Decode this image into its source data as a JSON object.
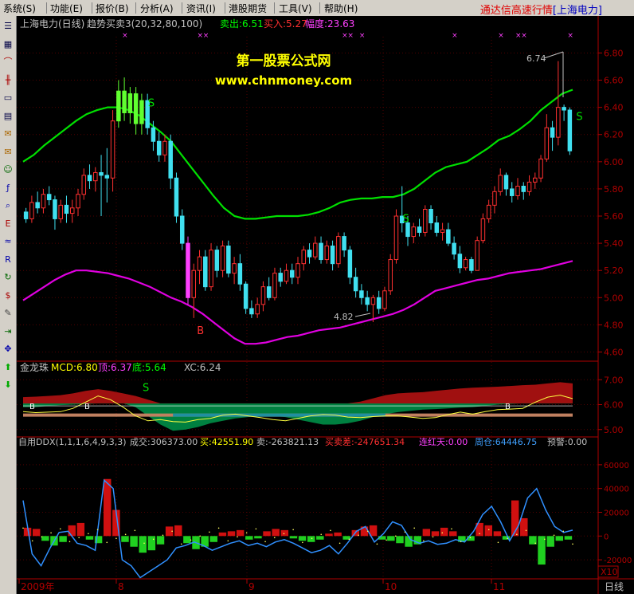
{
  "menu": [
    "系统(S)",
    "功能(E)",
    "报价(B)",
    "分析(A)",
    "资讯(I)",
    "港股期货",
    "工具(V)",
    "帮助(H)"
  ],
  "app_title": {
    "prefix": "通达信高速行情",
    "stock": "[上海电力]"
  },
  "toolbar_icons": [
    "list-icon",
    "grid-icon",
    "line-chart-icon",
    "candle-chart-icon",
    "window-icon",
    "table-icon",
    "news-icon",
    "mail-icon",
    "users-icon",
    "fund-icon",
    "search-icon",
    "etf-icon",
    "wave-icon",
    "rsi-icon",
    "refresh-icon",
    "dollar-icon",
    "tools-icon",
    "exit-icon",
    "move-icon",
    "up-arrow-icon",
    "down-arrow-icon"
  ],
  "main_header": {
    "title": "上海电力(日线)",
    "indicator": "趋势买卖3(20,32,80,100)",
    "sell": "卖出:6.51",
    "buy": "买入:5.27",
    "amp": "幅度:23.63",
    "colors": {
      "title": "#c0c0c0",
      "sell": "#00ff00",
      "buy": "#ff3030",
      "amp": "#ff40ff"
    }
  },
  "watermark": {
    "line1": "第一股票公式网",
    "line2": "www.chnmoney.com"
  },
  "price_annotations": {
    "high": "6.74",
    "low": "4.82"
  },
  "signal_labels": {
    "sell": "S",
    "buy": "B"
  },
  "price_axis": [
    "6.80",
    "6.60",
    "6.40",
    "6.20",
    "6.00",
    "5.80",
    "5.60",
    "5.40",
    "5.20",
    "5.00",
    "4.80",
    "4.60"
  ],
  "mcd_header": {
    "name": "金龙珠",
    "mcd": "MCD:6.80",
    "top": "顶:6.37",
    "bottom": "底:5.64",
    "xc": "XC:6.24"
  },
  "mcd_axis": [
    "7.00",
    "6.00",
    "5.00"
  ],
  "ddx_header": {
    "name": "自用DDX(1,1,1,6,4,9,3,3)",
    "vol": "成交:306373.00",
    "buy": "买:42551.90",
    "sell": "卖:-263821.13",
    "diff": "买卖差:-247651.34",
    "red": "连红天:0.00",
    "week": "周仓:64446.75",
    "warn": "预警:0.00"
  },
  "ddx_axis": [
    "60000",
    "40000",
    "20000",
    "0",
    "-20000"
  ],
  "ddx_scale": "X10",
  "date_axis": [
    "2009年",
    "8",
    "9",
    "10",
    "11"
  ],
  "period_label": "日线",
  "chart_data": [
    {
      "type": "candlestick",
      "name": "main",
      "ylim": [
        4.55,
        6.92
      ],
      "ohlc": [
        [
          5.63,
          5.66,
          5.55,
          5.58
        ],
        [
          5.58,
          5.75,
          5.55,
          5.7
        ],
        [
          5.7,
          5.78,
          5.62,
          5.66
        ],
        [
          5.66,
          5.8,
          5.62,
          5.76
        ],
        [
          5.76,
          5.82,
          5.68,
          5.72
        ],
        [
          5.72,
          5.75,
          5.5,
          5.58
        ],
        [
          5.58,
          5.72,
          5.55,
          5.68
        ],
        [
          5.68,
          5.75,
          5.55,
          5.62
        ],
        [
          5.62,
          5.72,
          5.55,
          5.66
        ],
        [
          5.66,
          5.8,
          5.6,
          5.76
        ],
        [
          5.76,
          5.95,
          5.72,
          5.9
        ],
        [
          5.9,
          5.98,
          5.8,
          5.86
        ],
        [
          5.86,
          5.96,
          5.78,
          5.92
        ],
        [
          5.92,
          6.05,
          5.6,
          5.9
        ],
        [
          5.9,
          6.1,
          5.7,
          5.88
        ],
        [
          5.88,
          6.38,
          5.78,
          6.3
        ],
        [
          6.3,
          6.6,
          6.25,
          6.52
        ],
        [
          6.52,
          6.62,
          6.3,
          6.36
        ],
        [
          6.36,
          6.55,
          6.28,
          6.5
        ],
        [
          6.5,
          6.55,
          6.2,
          6.28
        ],
        [
          6.28,
          6.5,
          6.2,
          6.45
        ],
        [
          6.45,
          6.5,
          6.2,
          6.25
        ],
        [
          6.25,
          6.3,
          6.08,
          6.15
        ],
        [
          6.15,
          6.22,
          6.0,
          6.05
        ],
        [
          6.05,
          6.2,
          6.0,
          6.15
        ],
        [
          6.15,
          6.2,
          5.8,
          5.88
        ],
        [
          5.88,
          5.92,
          5.55,
          5.6
        ],
        [
          5.6,
          5.65,
          5.35,
          5.4
        ],
        [
          5.4,
          5.45,
          4.95,
          5.0
        ],
        [
          5.0,
          5.25,
          4.85,
          5.2
        ],
        [
          5.2,
          5.35,
          5.1,
          5.3
        ],
        [
          5.3,
          5.35,
          5.05,
          5.08
        ],
        [
          5.08,
          5.4,
          5.05,
          5.35
        ],
        [
          5.35,
          5.38,
          5.15,
          5.2
        ],
        [
          5.2,
          5.42,
          5.15,
          5.38
        ],
        [
          5.38,
          5.42,
          5.15,
          5.18
        ],
        [
          5.18,
          5.3,
          5.1,
          5.25
        ],
        [
          5.25,
          5.32,
          5.05,
          5.1
        ],
        [
          5.1,
          5.12,
          4.88,
          4.92
        ],
        [
          4.92,
          4.98,
          4.85,
          4.88
        ],
        [
          4.88,
          5.0,
          4.85,
          4.95
        ],
        [
          4.95,
          5.12,
          4.9,
          5.08
        ],
        [
          5.08,
          5.15,
          4.98,
          5.0
        ],
        [
          5.0,
          5.22,
          4.98,
          5.18
        ],
        [
          5.18,
          5.22,
          5.08,
          5.12
        ],
        [
          5.12,
          5.25,
          5.1,
          5.2
        ],
        [
          5.2,
          5.25,
          5.1,
          5.15
        ],
        [
          5.15,
          5.3,
          5.1,
          5.25
        ],
        [
          5.25,
          5.38,
          5.2,
          5.35
        ],
        [
          5.35,
          5.4,
          5.25,
          5.3
        ],
        [
          5.3,
          5.45,
          5.28,
          5.4
        ],
        [
          5.4,
          5.45,
          5.25,
          5.28
        ],
        [
          5.28,
          5.42,
          5.25,
          5.38
        ],
        [
          5.38,
          5.42,
          5.2,
          5.25
        ],
        [
          5.25,
          5.48,
          5.22,
          5.45
        ],
        [
          5.45,
          5.48,
          5.3,
          5.35
        ],
        [
          5.35,
          5.38,
          5.1,
          5.15
        ],
        [
          5.15,
          5.22,
          5.0,
          5.05
        ],
        [
          5.05,
          5.1,
          4.95,
          5.0
        ],
        [
          5.0,
          5.05,
          4.9,
          4.95
        ],
        [
          4.95,
          5.02,
          4.82,
          5.0
        ],
        [
          5.0,
          5.05,
          4.88,
          4.92
        ],
        [
          4.92,
          5.08,
          4.9,
          5.05
        ],
        [
          5.05,
          5.32,
          5.02,
          5.28
        ],
        [
          5.28,
          5.65,
          5.25,
          5.6
        ],
        [
          5.6,
          5.82,
          5.48,
          5.55
        ],
        [
          5.55,
          5.6,
          5.38,
          5.45
        ],
        [
          5.45,
          5.55,
          5.4,
          5.52
        ],
        [
          5.52,
          5.58,
          5.45,
          5.48
        ],
        [
          5.48,
          5.68,
          5.45,
          5.65
        ],
        [
          5.65,
          5.68,
          5.5,
          5.55
        ],
        [
          5.55,
          5.6,
          5.45,
          5.48
        ],
        [
          5.48,
          5.55,
          5.42,
          5.5
        ],
        [
          5.5,
          5.55,
          5.38,
          5.4
        ],
        [
          5.4,
          5.45,
          5.28,
          5.32
        ],
        [
          5.32,
          5.38,
          5.18,
          5.22
        ],
        [
          5.22,
          5.3,
          5.2,
          5.28
        ],
        [
          5.28,
          5.3,
          5.18,
          5.2
        ],
        [
          5.2,
          5.45,
          5.2,
          5.42
        ],
        [
          5.42,
          5.62,
          5.4,
          5.58
        ],
        [
          5.58,
          5.72,
          5.55,
          5.68
        ],
        [
          5.68,
          5.82,
          5.62,
          5.78
        ],
        [
          5.78,
          5.95,
          5.75,
          5.9
        ],
        [
          5.9,
          5.92,
          5.75,
          5.8
        ],
        [
          5.8,
          5.85,
          5.7,
          5.75
        ],
        [
          5.75,
          5.88,
          5.72,
          5.82
        ],
        [
          5.82,
          5.85,
          5.72,
          5.78
        ],
        [
          5.78,
          5.9,
          5.75,
          5.85
        ],
        [
          5.85,
          5.92,
          5.8,
          5.88
        ],
        [
          5.88,
          6.05,
          5.85,
          6.02
        ],
        [
          6.02,
          6.35,
          6.0,
          6.25
        ],
        [
          6.25,
          6.3,
          6.08,
          6.18
        ],
        [
          6.18,
          6.74,
          6.12,
          6.4
        ],
        [
          6.4,
          6.42,
          6.3,
          6.38
        ],
        [
          6.38,
          6.4,
          6.05,
          6.08
        ]
      ],
      "upper_band": [
        6.0,
        6.05,
        6.12,
        6.18,
        6.24,
        6.3,
        6.35,
        6.38,
        6.4,
        6.4,
        6.38,
        6.34,
        6.28,
        6.22,
        6.15,
        6.05,
        5.95,
        5.85,
        5.75,
        5.66,
        5.6,
        5.58,
        5.58,
        5.59,
        5.6,
        5.6,
        5.6,
        5.61,
        5.63,
        5.66,
        5.7,
        5.72,
        5.73,
        5.73,
        5.74,
        5.74,
        5.76,
        5.8,
        5.86,
        5.92,
        5.96,
        5.98,
        6.0,
        6.05,
        6.1,
        6.16,
        6.19,
        6.24,
        6.3,
        6.38,
        6.44,
        6.5,
        6.53
      ],
      "lower_band": [
        4.98,
        5.03,
        5.08,
        5.13,
        5.17,
        5.2,
        5.2,
        5.19,
        5.18,
        5.16,
        5.14,
        5.11,
        5.08,
        5.04,
        5.0,
        4.97,
        4.93,
        4.88,
        4.82,
        4.76,
        4.7,
        4.66,
        4.66,
        4.67,
        4.69,
        4.71,
        4.72,
        4.74,
        4.76,
        4.77,
        4.78,
        4.8,
        4.82,
        4.84,
        4.86,
        4.88,
        4.91,
        4.95,
        5.0,
        5.05,
        5.07,
        5.09,
        5.11,
        5.13,
        5.14,
        5.16,
        5.18,
        5.19,
        5.2,
        5.21,
        5.23,
        5.25,
        5.27
      ],
      "signals": [
        {
          "label": "S",
          "at": 20
        },
        {
          "label": "B",
          "at": 29
        },
        {
          "label": "S",
          "at": 64
        },
        {
          "label": "S",
          "at": 94
        }
      ]
    },
    {
      "type": "area",
      "name": "金龙珠",
      "ylim": [
        4.8,
        7.2
      ],
      "upper": [
        6.3,
        6.32,
        6.35,
        6.38,
        6.45,
        6.55,
        6.62,
        6.55,
        6.45,
        6.35,
        6.2,
        6.05,
        6.05,
        6.05,
        6.05,
        6.05,
        6.05,
        6.05,
        6.05,
        6.05,
        6.05,
        6.05,
        6.05,
        6.05,
        6.05,
        6.05,
        6.05,
        6.12,
        6.25,
        6.38,
        6.45,
        6.48,
        6.5,
        6.55,
        6.6,
        6.65,
        6.68,
        6.7,
        6.72,
        6.75,
        6.78,
        6.8,
        6.85,
        6.9,
        6.85
      ],
      "lower": [
        5.9,
        5.9,
        5.95,
        5.98,
        6.0,
        6.02,
        6.05,
        6.05,
        6.05,
        5.9,
        5.55,
        5.2,
        4.95,
        5.0,
        5.1,
        5.25,
        5.35,
        5.45,
        5.5,
        5.55,
        5.55,
        5.5,
        5.4,
        5.3,
        5.2,
        5.2,
        5.25,
        5.35,
        5.5,
        5.62,
        5.7,
        5.75,
        5.8,
        5.82,
        5.85,
        5.88,
        5.9,
        5.95,
        6.0,
        6.03,
        6.05,
        6.05,
        6.05,
        6.05,
        6.05
      ],
      "xc": [
        5.72,
        5.68,
        5.7,
        5.72,
        5.85,
        6.1,
        6.35,
        6.2,
        5.9,
        5.55,
        5.35,
        5.4,
        5.32,
        5.3,
        5.4,
        5.45,
        5.58,
        5.62,
        5.55,
        5.48,
        5.4,
        5.35,
        5.45,
        5.55,
        5.6,
        5.58,
        5.5,
        5.48,
        5.52,
        5.55,
        5.55,
        5.5,
        5.45,
        5.48,
        5.6,
        5.7,
        5.62,
        5.72,
        5.8,
        5.82,
        5.85,
        6.1,
        6.3,
        6.38,
        6.24
      ],
      "level_bottom": 5.64
    },
    {
      "type": "bar",
      "name": "DDX",
      "ylim": [
        -32000,
        72000
      ],
      "values": [
        7000,
        6000,
        -4000,
        -8000,
        -5000,
        9000,
        11000,
        -3000,
        -6000,
        48000,
        22000,
        -5000,
        -9000,
        -14000,
        -12000,
        -7000,
        8000,
        9000,
        -6000,
        -11000,
        -9000,
        -5000,
        3000,
        4000,
        5000,
        -3000,
        -2000,
        4000,
        6000,
        5000,
        -2000,
        -4000,
        -5000,
        -3000,
        2000,
        3000,
        -3000,
        5000,
        8000,
        9000,
        -3000,
        -4000,
        -6000,
        -9000,
        -7000,
        6000,
        4000,
        7000,
        4000,
        -5000,
        -4000,
        11000,
        9000,
        4000,
        -3000,
        30000,
        15000,
        -7000,
        -24000,
        -9000,
        -4000,
        -3000
      ],
      "ddx_line": [
        30000,
        -15000,
        -25000,
        -10000,
        3000,
        4000,
        -6000,
        -8000,
        -12000,
        47000,
        40000,
        -20000,
        -25000,
        -35000,
        -30000,
        -25000,
        -20000,
        -10000,
        -8000,
        -5000,
        -8000,
        -12000,
        -9000,
        -6000,
        -4000,
        -8000,
        -6000,
        -9000,
        -5000,
        -3000,
        -6000,
        -10000,
        -14000,
        -12000,
        -8000,
        -15000,
        -6000,
        4000,
        8000,
        -5000,
        2000,
        12000,
        9000,
        -3000,
        -6000,
        -4000,
        -7000,
        -6000,
        -3000,
        -5000,
        4000,
        18000,
        25000,
        12000,
        -4000,
        9000,
        32000,
        40000,
        22000,
        8000,
        3000,
        5000
      ]
    }
  ]
}
